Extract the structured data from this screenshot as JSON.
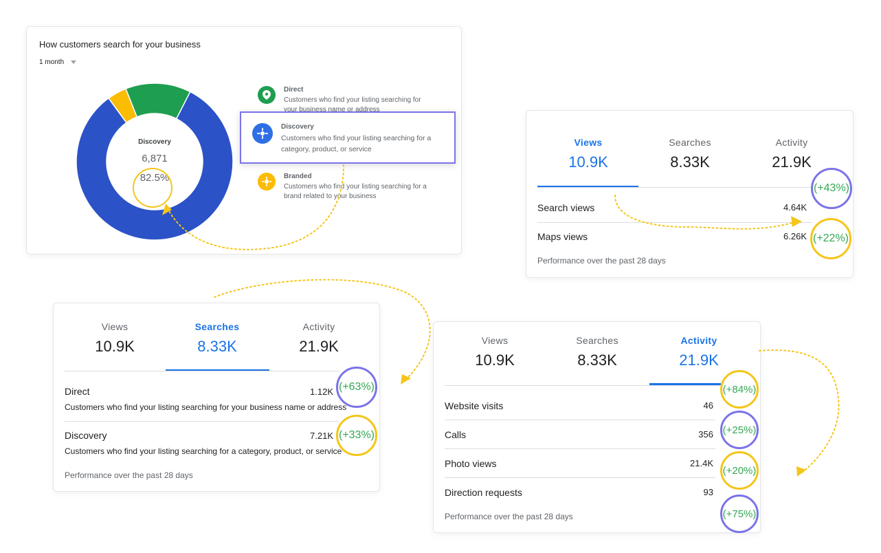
{
  "donut_card": {
    "title": "How customers search for your business",
    "period": "1 month",
    "center_label": "Discovery",
    "center_value": "6,871",
    "center_pct": "82.5%",
    "legend": [
      {
        "name": "Direct",
        "desc": "Customers who find your listing searching for your business name or address",
        "color": "#1e9e50",
        "icon": "location-pin-icon"
      },
      {
        "name": "Discovery",
        "desc": "Customers who find your listing searching for a category, product, or service",
        "color": "#2f6fe6",
        "icon": "discovery-gear-icon"
      },
      {
        "name": "Branded",
        "desc": "Customers who find your listing searching for a brand related to your business",
        "color": "#fbbc04",
        "icon": "branded-sun-icon"
      }
    ]
  },
  "chart_data": {
    "type": "pie",
    "categories": [
      "Discovery",
      "Direct",
      "Branded"
    ],
    "values": [
      82.5,
      13.5,
      4.0
    ],
    "colors": [
      "#2b52c7",
      "#1e9e50",
      "#fbbc04"
    ],
    "title": "How customers search for your business"
  },
  "views_card": {
    "tabs": [
      {
        "label": "Views",
        "value": "10.9K"
      },
      {
        "label": "Searches",
        "value": "8.33K"
      },
      {
        "label": "Activity",
        "value": "21.9K"
      }
    ],
    "rows": [
      {
        "label": "Search views",
        "value": "4.64K",
        "change": "(+43%)"
      },
      {
        "label": "Maps views",
        "value": "6.26K",
        "change": "(+22%)"
      }
    ],
    "footer": "Performance over the past 28 days"
  },
  "searches_card": {
    "tabs": [
      {
        "label": "Views",
        "value": "10.9K"
      },
      {
        "label": "Searches",
        "value": "8.33K"
      },
      {
        "label": "Activity",
        "value": "21.9K"
      }
    ],
    "rows": [
      {
        "label": "Direct",
        "value": "1.12K",
        "desc": "Customers who find your listing searching for your business name or address",
        "change": "(+63%)"
      },
      {
        "label": "Discovery",
        "value": "7.21K",
        "desc": "Customers who find your listing searching for a category, product, or service",
        "change": "(+33%)"
      }
    ],
    "footer": "Performance over the past 28 days"
  },
  "activity_card": {
    "tabs": [
      {
        "label": "Views",
        "value": "10.9K"
      },
      {
        "label": "Searches",
        "value": "8.33K"
      },
      {
        "label": "Activity",
        "value": "21.9K"
      }
    ],
    "rows": [
      {
        "label": "Website visits",
        "value": "46",
        "change": "(+84%)"
      },
      {
        "label": "Calls",
        "value": "356",
        "change": "(+25%)"
      },
      {
        "label": "Photo views",
        "value": "21.4K",
        "change": "(+20%)"
      },
      {
        "label": "Direction requests",
        "value": "93",
        "change": "(+75%)"
      }
    ],
    "footer": "Performance over the past 28 days"
  }
}
